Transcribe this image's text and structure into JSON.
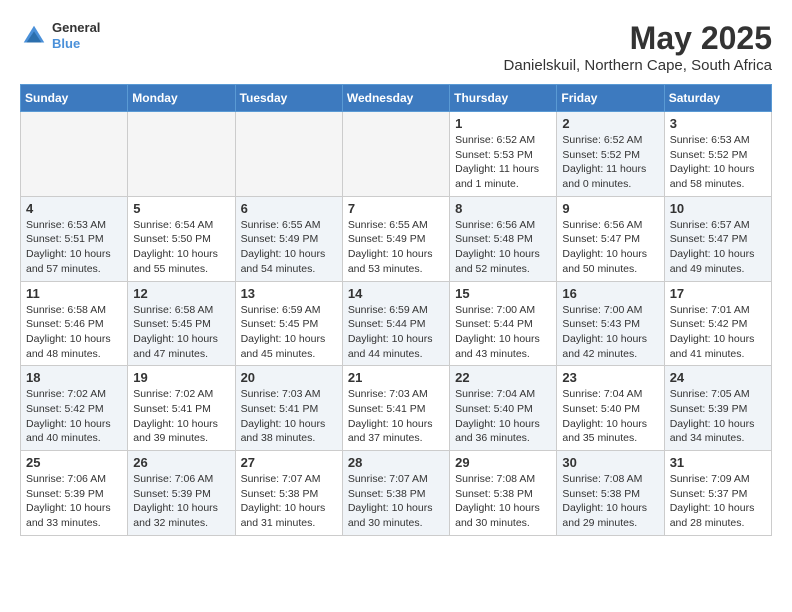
{
  "header": {
    "logo_line1": "General",
    "logo_line2": "Blue",
    "main_title": "May 2025",
    "subtitle": "Danielskuil, Northern Cape, South Africa"
  },
  "calendar": {
    "days_of_week": [
      "Sunday",
      "Monday",
      "Tuesday",
      "Wednesday",
      "Thursday",
      "Friday",
      "Saturday"
    ],
    "weeks": [
      [
        {
          "day": "",
          "info": "",
          "empty": true
        },
        {
          "day": "",
          "info": "",
          "empty": true
        },
        {
          "day": "",
          "info": "",
          "empty": true
        },
        {
          "day": "",
          "info": "",
          "empty": true
        },
        {
          "day": "1",
          "info": "Sunrise: 6:52 AM\nSunset: 5:53 PM\nDaylight: 11 hours\nand 1 minute.",
          "shaded": false
        },
        {
          "day": "2",
          "info": "Sunrise: 6:52 AM\nSunset: 5:52 PM\nDaylight: 11 hours\nand 0 minutes.",
          "shaded": true
        },
        {
          "day": "3",
          "info": "Sunrise: 6:53 AM\nSunset: 5:52 PM\nDaylight: 10 hours\nand 58 minutes.",
          "shaded": false
        }
      ],
      [
        {
          "day": "4",
          "info": "Sunrise: 6:53 AM\nSunset: 5:51 PM\nDaylight: 10 hours\nand 57 minutes.",
          "shaded": true
        },
        {
          "day": "5",
          "info": "Sunrise: 6:54 AM\nSunset: 5:50 PM\nDaylight: 10 hours\nand 55 minutes.",
          "shaded": false
        },
        {
          "day": "6",
          "info": "Sunrise: 6:55 AM\nSunset: 5:49 PM\nDaylight: 10 hours\nand 54 minutes.",
          "shaded": true
        },
        {
          "day": "7",
          "info": "Sunrise: 6:55 AM\nSunset: 5:49 PM\nDaylight: 10 hours\nand 53 minutes.",
          "shaded": false
        },
        {
          "day": "8",
          "info": "Sunrise: 6:56 AM\nSunset: 5:48 PM\nDaylight: 10 hours\nand 52 minutes.",
          "shaded": true
        },
        {
          "day": "9",
          "info": "Sunrise: 6:56 AM\nSunset: 5:47 PM\nDaylight: 10 hours\nand 50 minutes.",
          "shaded": false
        },
        {
          "day": "10",
          "info": "Sunrise: 6:57 AM\nSunset: 5:47 PM\nDaylight: 10 hours\nand 49 minutes.",
          "shaded": true
        }
      ],
      [
        {
          "day": "11",
          "info": "Sunrise: 6:58 AM\nSunset: 5:46 PM\nDaylight: 10 hours\nand 48 minutes.",
          "shaded": false
        },
        {
          "day": "12",
          "info": "Sunrise: 6:58 AM\nSunset: 5:45 PM\nDaylight: 10 hours\nand 47 minutes.",
          "shaded": true
        },
        {
          "day": "13",
          "info": "Sunrise: 6:59 AM\nSunset: 5:45 PM\nDaylight: 10 hours\nand 45 minutes.",
          "shaded": false
        },
        {
          "day": "14",
          "info": "Sunrise: 6:59 AM\nSunset: 5:44 PM\nDaylight: 10 hours\nand 44 minutes.",
          "shaded": true
        },
        {
          "day": "15",
          "info": "Sunrise: 7:00 AM\nSunset: 5:44 PM\nDaylight: 10 hours\nand 43 minutes.",
          "shaded": false
        },
        {
          "day": "16",
          "info": "Sunrise: 7:00 AM\nSunset: 5:43 PM\nDaylight: 10 hours\nand 42 minutes.",
          "shaded": true
        },
        {
          "day": "17",
          "info": "Sunrise: 7:01 AM\nSunset: 5:42 PM\nDaylight: 10 hours\nand 41 minutes.",
          "shaded": false
        }
      ],
      [
        {
          "day": "18",
          "info": "Sunrise: 7:02 AM\nSunset: 5:42 PM\nDaylight: 10 hours\nand 40 minutes.",
          "shaded": true
        },
        {
          "day": "19",
          "info": "Sunrise: 7:02 AM\nSunset: 5:41 PM\nDaylight: 10 hours\nand 39 minutes.",
          "shaded": false
        },
        {
          "day": "20",
          "info": "Sunrise: 7:03 AM\nSunset: 5:41 PM\nDaylight: 10 hours\nand 38 minutes.",
          "shaded": true
        },
        {
          "day": "21",
          "info": "Sunrise: 7:03 AM\nSunset: 5:41 PM\nDaylight: 10 hours\nand 37 minutes.",
          "shaded": false
        },
        {
          "day": "22",
          "info": "Sunrise: 7:04 AM\nSunset: 5:40 PM\nDaylight: 10 hours\nand 36 minutes.",
          "shaded": true
        },
        {
          "day": "23",
          "info": "Sunrise: 7:04 AM\nSunset: 5:40 PM\nDaylight: 10 hours\nand 35 minutes.",
          "shaded": false
        },
        {
          "day": "24",
          "info": "Sunrise: 7:05 AM\nSunset: 5:39 PM\nDaylight: 10 hours\nand 34 minutes.",
          "shaded": true
        }
      ],
      [
        {
          "day": "25",
          "info": "Sunrise: 7:06 AM\nSunset: 5:39 PM\nDaylight: 10 hours\nand 33 minutes.",
          "shaded": false
        },
        {
          "day": "26",
          "info": "Sunrise: 7:06 AM\nSunset: 5:39 PM\nDaylight: 10 hours\nand 32 minutes.",
          "shaded": true
        },
        {
          "day": "27",
          "info": "Sunrise: 7:07 AM\nSunset: 5:38 PM\nDaylight: 10 hours\nand 31 minutes.",
          "shaded": false
        },
        {
          "day": "28",
          "info": "Sunrise: 7:07 AM\nSunset: 5:38 PM\nDaylight: 10 hours\nand 30 minutes.",
          "shaded": true
        },
        {
          "day": "29",
          "info": "Sunrise: 7:08 AM\nSunset: 5:38 PM\nDaylight: 10 hours\nand 30 minutes.",
          "shaded": false
        },
        {
          "day": "30",
          "info": "Sunrise: 7:08 AM\nSunset: 5:38 PM\nDaylight: 10 hours\nand 29 minutes.",
          "shaded": true
        },
        {
          "day": "31",
          "info": "Sunrise: 7:09 AM\nSunset: 5:37 PM\nDaylight: 10 hours\nand 28 minutes.",
          "shaded": false
        }
      ]
    ]
  }
}
